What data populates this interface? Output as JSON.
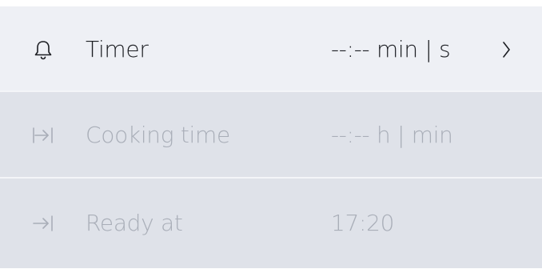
{
  "rows": [
    {
      "icon": "bell-icon",
      "label": "Timer",
      "value": "--:--  min | s",
      "enabled": true
    },
    {
      "icon": "duration-icon",
      "label": "Cooking time",
      "value": "--:--  h | min",
      "enabled": false
    },
    {
      "icon": "end-time-icon",
      "label": "Ready at",
      "value": "17:20",
      "enabled": false
    }
  ],
  "colors": {
    "active_row_bg": "#eef0f5",
    "disabled_row_bg": "#dfe2e9",
    "active_text": "#1b1d22",
    "disabled_text": "#a9aeb8"
  }
}
